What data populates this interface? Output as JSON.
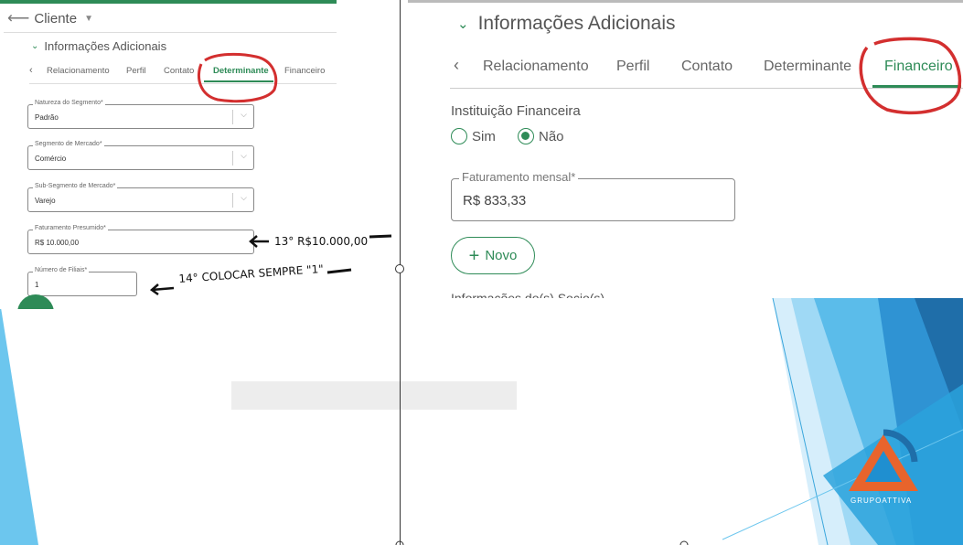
{
  "left": {
    "back_label": "Cliente",
    "section_title": "Informações Adicionais",
    "tabs": [
      "Relacionamento",
      "Perfil",
      "Contato",
      "Determinante",
      "Financeiro"
    ],
    "active_tab": "Determinante",
    "fields": [
      {
        "label": "Natureza do Segmento*",
        "value": "Padrão",
        "type": "select"
      },
      {
        "label": "Segmento de Mercado*",
        "value": "Comércio",
        "type": "select"
      },
      {
        "label": "Sub-Segmento de Mercado*",
        "value": "Varejo",
        "type": "select"
      },
      {
        "label": "Faturamento Presumido*",
        "value": "R$ 10.000,00",
        "type": "text"
      },
      {
        "label": "Número de Filiais*",
        "value": "1",
        "type": "text"
      }
    ]
  },
  "right": {
    "section_title": "Informações Adicionais",
    "tabs": [
      "Relacionamento",
      "Perfil",
      "Contato",
      "Determinante",
      "Financeiro"
    ],
    "active_tab": "Financeiro",
    "institution_label": "Instituição Financeira",
    "radio_sim": "Sim",
    "radio_nao": "Não",
    "selected_radio": "Não",
    "revenue_label": "Faturamento mensal*",
    "revenue_value": "R$ 833,33",
    "new_button": "Novo",
    "partners_label": "Informações do(s) Socio(s)"
  },
  "annotations": {
    "note_13": "13° R$10.000,00",
    "note_14": "14° COLOCAR SEMPRE \"1\""
  },
  "logo_text": "GRUPOATTIVA",
  "colors": {
    "accent": "#2e8b57",
    "highlight": "#d32f2f",
    "logo_orange": "#e8642c",
    "slide_blue": "#1f8fd0"
  }
}
